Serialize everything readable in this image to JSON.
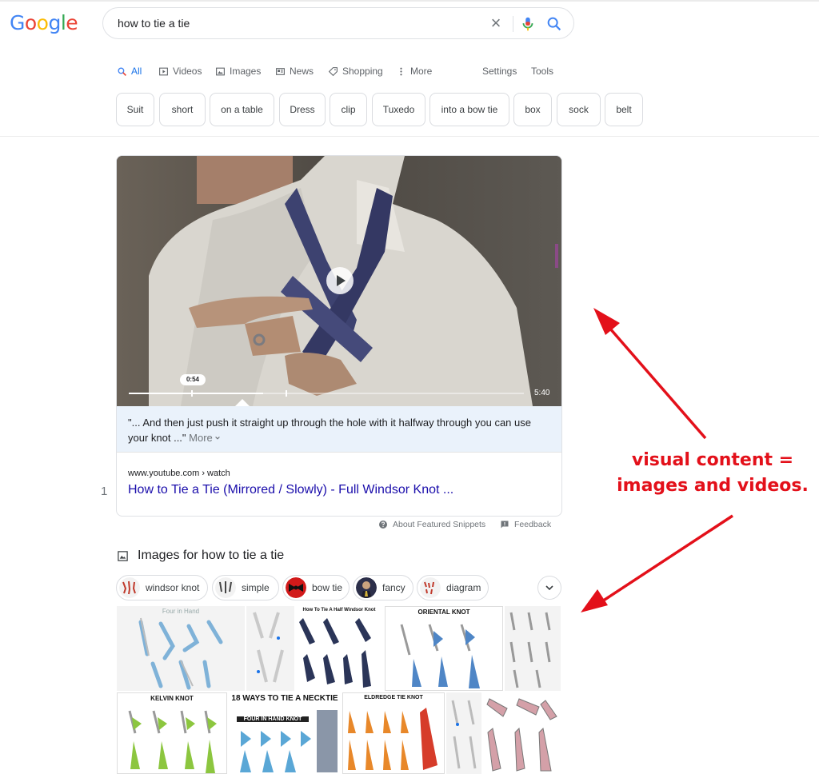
{
  "logo": "Google",
  "search": {
    "query": "how to tie a tie"
  },
  "tabs": [
    {
      "label": "All",
      "icon": "search-icon"
    },
    {
      "label": "Videos",
      "icon": "video-icon"
    },
    {
      "label": "Images",
      "icon": "image-icon"
    },
    {
      "label": "News",
      "icon": "news-icon"
    },
    {
      "label": "Shopping",
      "icon": "tag-icon"
    },
    {
      "label": "More",
      "icon": "more-vert-icon"
    },
    {
      "label": "Settings"
    },
    {
      "label": "Tools"
    }
  ],
  "chips": [
    "Suit",
    "short",
    "on a table",
    "Dress",
    "clip",
    "Tuxedo",
    "into a bow tie",
    "box",
    "sock",
    "belt"
  ],
  "featured": {
    "time_tooltip": "0:54",
    "duration": "5:40",
    "progress_fraction": 0.34,
    "snippet": "\"... And then just push it straight up through the hole with it halfway through you can use your knot ...\"",
    "more_label": "More",
    "cite": "www.youtube.com › watch",
    "title": "How to Tie a Tie (Mirrored / Slowly) - Full Windsor Knot ...",
    "result_number": "1"
  },
  "feedback": {
    "about": "About Featured Snippets",
    "feedback": "Feedback"
  },
  "images_section": {
    "heading": "Images for how to tie a tie",
    "pills": [
      "windsor knot",
      "simple",
      "bow tie",
      "fancy",
      "diagram"
    ],
    "thumb_captions": [
      "Four in Hand",
      "How To Tie A Half Windsor Knot",
      "ORIENTAL KNOT",
      "KELVIN KNOT",
      "18 WAYS TO TIE A NECKTIE",
      "FOUR IN HAND KNOT",
      "ELDREDGE TIE KNOT"
    ]
  },
  "annotation": {
    "line1": "visual content =",
    "line2": "images and videos."
  },
  "colors": {
    "link": "#1a0dab",
    "accent": "#1a73e8",
    "annotation": "#e3101a"
  }
}
